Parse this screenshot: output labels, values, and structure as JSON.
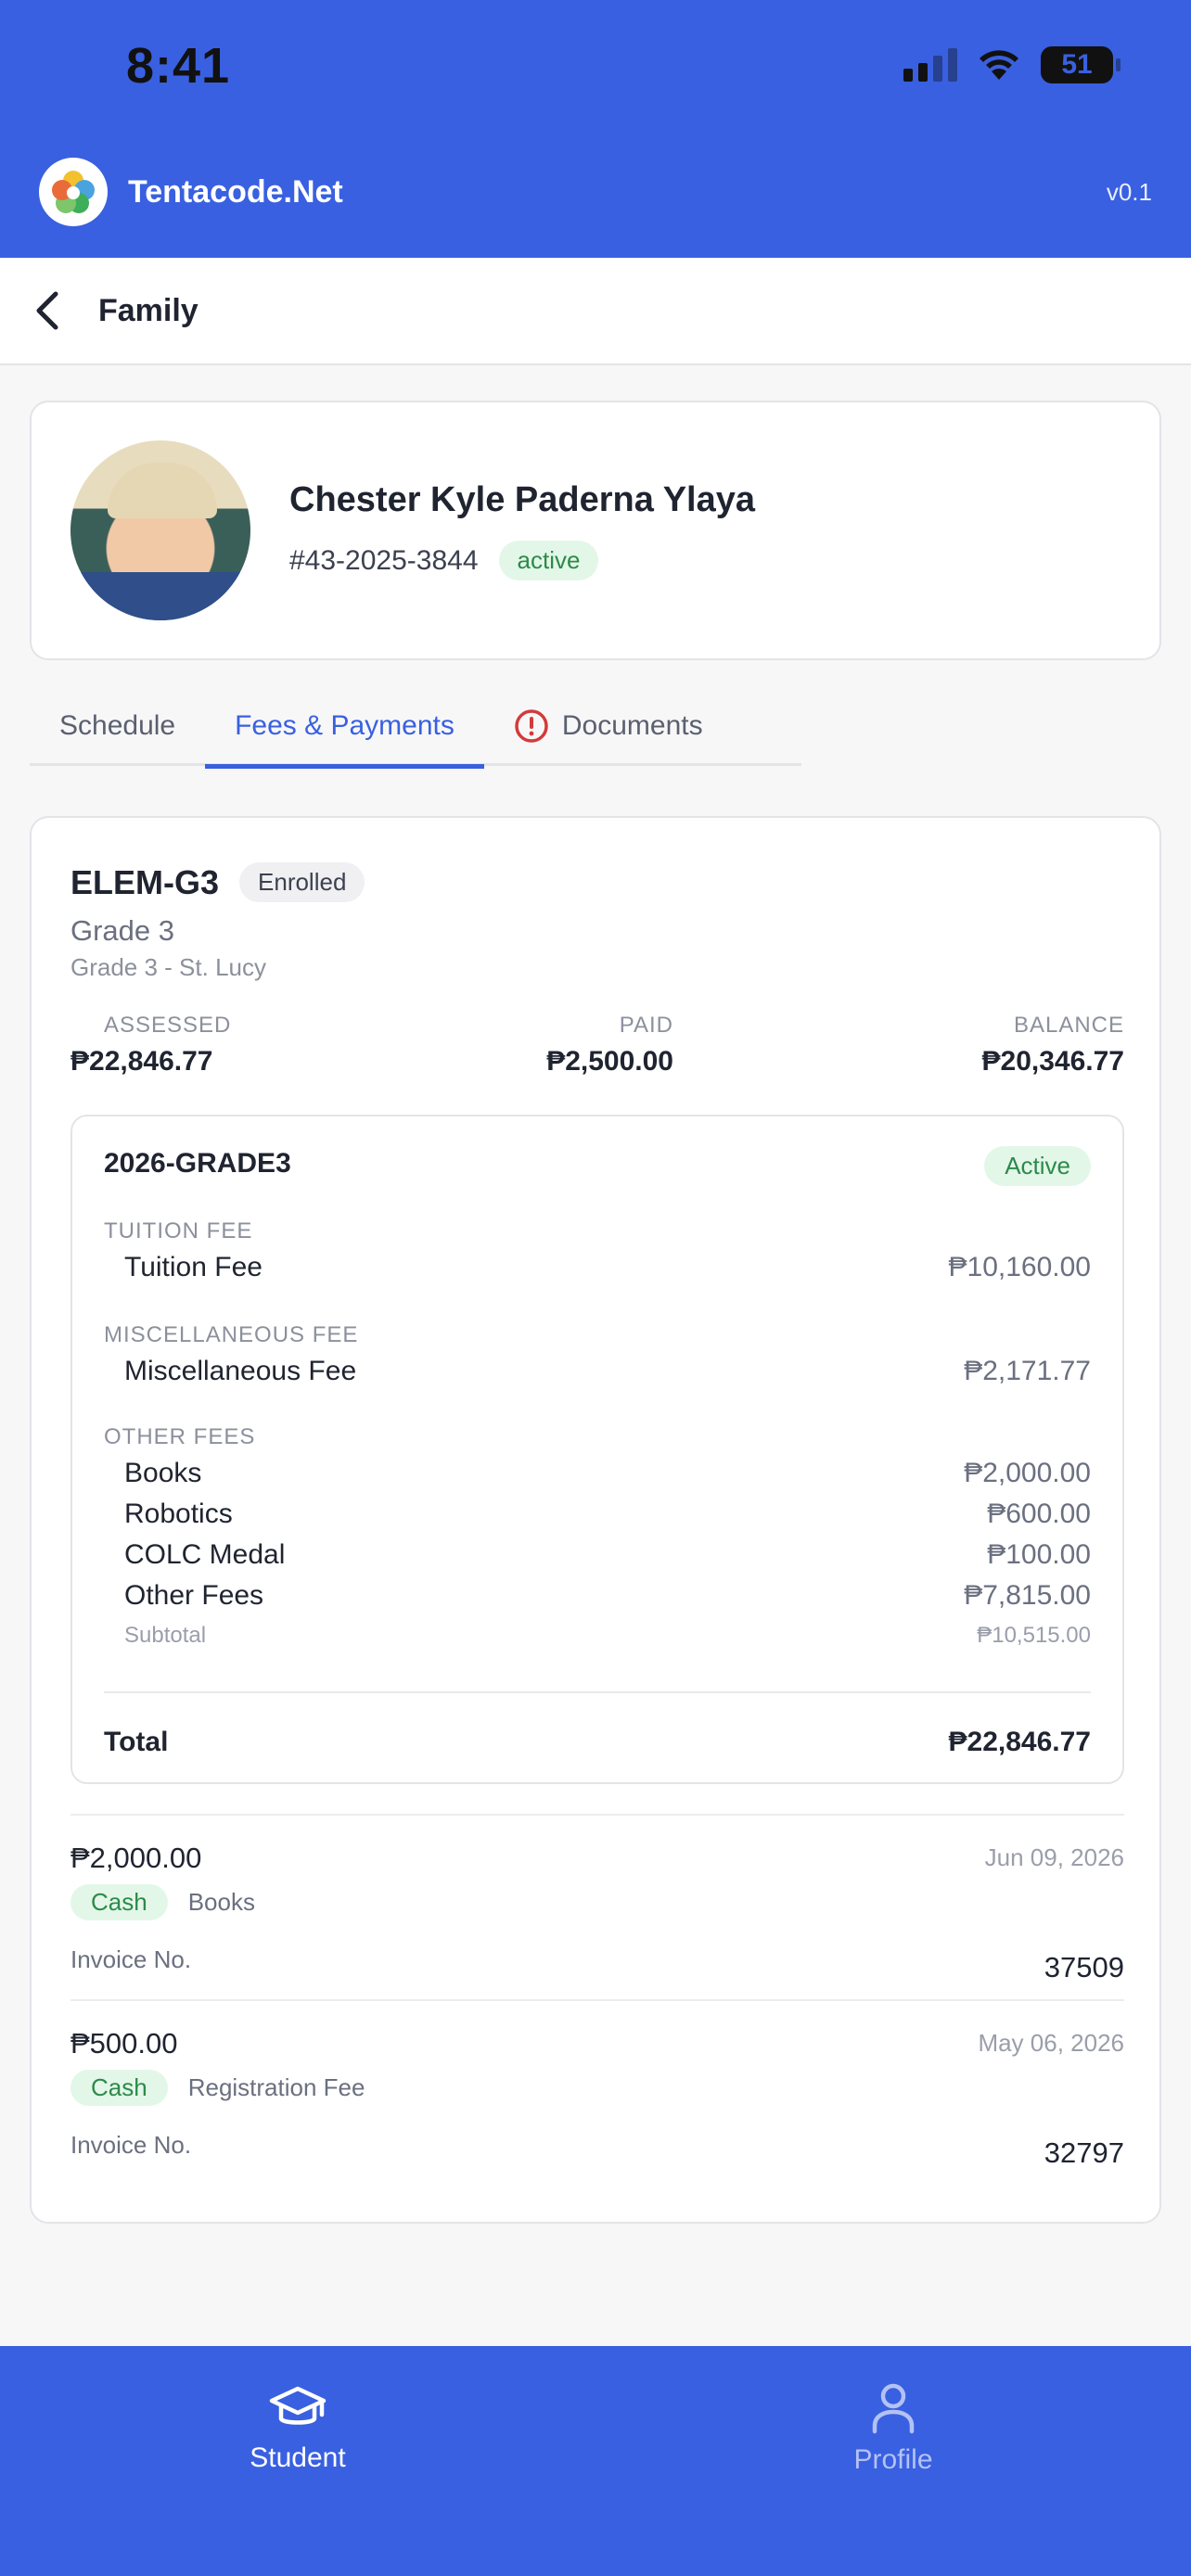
{
  "status_bar": {
    "time": "8:41",
    "battery": "51"
  },
  "app": {
    "name": "Tentacode.Net",
    "version": "v0.1"
  },
  "page": {
    "title": "Family"
  },
  "student": {
    "name": "Chester Kyle Paderna Ylaya",
    "id": "#43-2025-3844",
    "status": "active"
  },
  "tabs": [
    {
      "label": "Schedule"
    },
    {
      "label": "Fees & Payments"
    },
    {
      "label": "Documents"
    }
  ],
  "enrollment": {
    "code": "ELEM-G3",
    "status": "Enrolled",
    "grade": "Grade 3",
    "section": "Grade 3 - St. Lucy",
    "summary": {
      "assessed_label": "ASSESSED",
      "assessed": "₱22,846.77",
      "paid_label": "PAID",
      "paid": "₱2,500.00",
      "balance_label": "BALANCE",
      "balance": "₱20,346.77"
    },
    "fee_schedule": {
      "name": "2026-GRADE3",
      "status": "Active",
      "tuition_label": "TUITION FEE",
      "tuition": [
        {
          "name": "Tuition Fee",
          "amount": "₱10,160.00"
        }
      ],
      "misc_label": "MISCELLANEOUS FEE",
      "misc": [
        {
          "name": "Miscellaneous Fee",
          "amount": "₱2,171.77"
        }
      ],
      "other_label": "OTHER FEES",
      "other": [
        {
          "name": "Books",
          "amount": "₱2,000.00"
        },
        {
          "name": "Robotics",
          "amount": "₱600.00"
        },
        {
          "name": "COLC Medal",
          "amount": "₱100.00"
        },
        {
          "name": "Other Fees",
          "amount": "₱7,815.00"
        }
      ],
      "subtotal_label": "Subtotal",
      "subtotal": "₱10,515.00",
      "total_label": "Total",
      "total": "₱22,846.77"
    },
    "payments": [
      {
        "amount": "₱2,000.00",
        "date": "Jun 09, 2026",
        "method": "Cash",
        "description": "Books",
        "invoice_label": "Invoice No.",
        "invoice": "37509"
      },
      {
        "amount": "₱500.00",
        "date": "May 06, 2026",
        "method": "Cash",
        "description": "Registration Fee",
        "invoice_label": "Invoice No.",
        "invoice": "32797"
      }
    ]
  },
  "bottom_nav": [
    {
      "label": "Student",
      "icon": "graduation-cap-icon"
    },
    {
      "label": "Profile",
      "icon": "person-icon"
    }
  ],
  "colors": {
    "primary": "#3960e0",
    "success": "#2c8a4a",
    "success_bg": "#e3f7e8",
    "danger": "#d43a3a"
  }
}
